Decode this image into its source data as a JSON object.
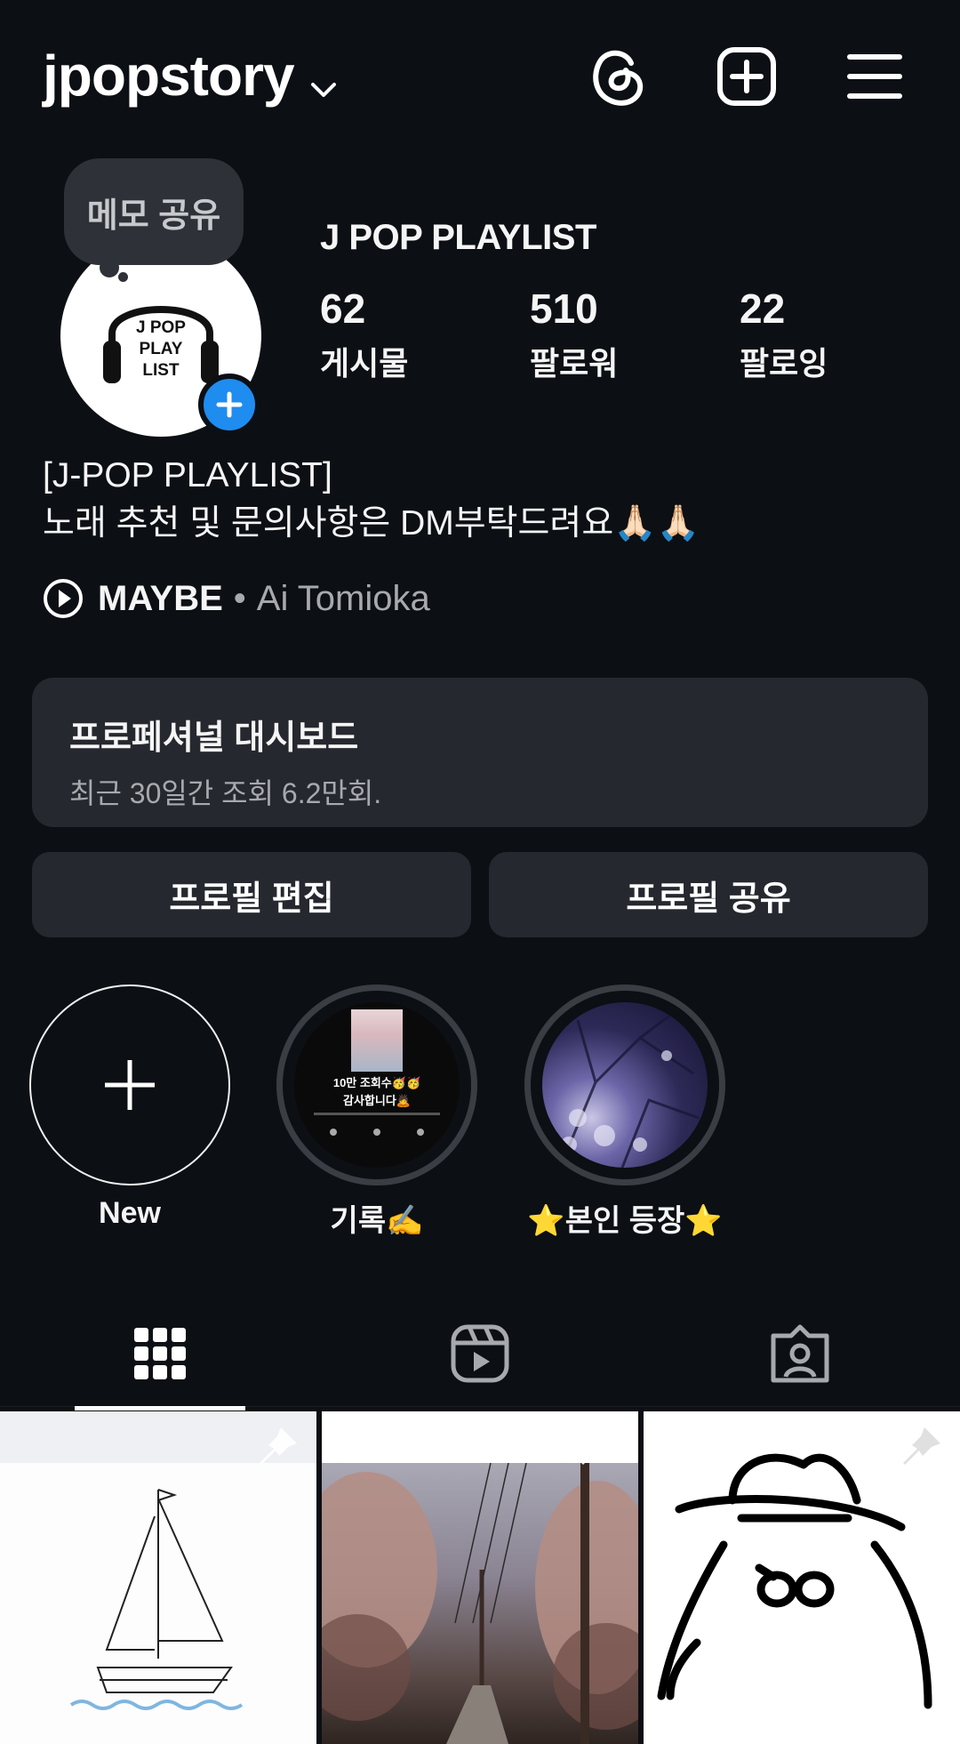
{
  "header": {
    "username": "jpopstory",
    "icons": [
      "threads-icon",
      "create-post-icon",
      "menu-icon"
    ]
  },
  "profile": {
    "memo_bubble": "메모 공유",
    "avatar_text_lines": [
      "J POP",
      "PLAY",
      "LIST"
    ],
    "display_name": "J POP PLAYLIST",
    "stats": [
      {
        "value": "62",
        "label": "게시물"
      },
      {
        "value": "510",
        "label": "팔로워"
      },
      {
        "value": "22",
        "label": "팔로잉"
      }
    ],
    "bio_line1": "[J-POP PLAYLIST]",
    "bio_line2": "노래 추천 및 문의사항은 DM부탁드려요🙏🏻🙏🏻",
    "music_title": "MAYBE",
    "music_separator": "•",
    "music_artist": "Ai Tomioka"
  },
  "dashboard": {
    "title": "프로페셔널 대시보드",
    "subtitle": "최근 30일간 조회 6.2만회."
  },
  "buttons": {
    "edit_profile": "프로필 편집",
    "share_profile": "프로필 공유"
  },
  "highlights": [
    {
      "label": "New"
    },
    {
      "label": "기록✍️",
      "thumb_line1": "10만 조회수🥳🥳",
      "thumb_line2": "감사합니다🙇"
    },
    {
      "label": "⭐본인 등장⭐"
    }
  ],
  "tabs": [
    "grid-icon",
    "reels-icon",
    "tagged-icon"
  ],
  "colors": {
    "background": "#0c0f14",
    "card": "#25282e",
    "accent": "#1f8cf0",
    "secondary_text": "#a8a9ad"
  }
}
